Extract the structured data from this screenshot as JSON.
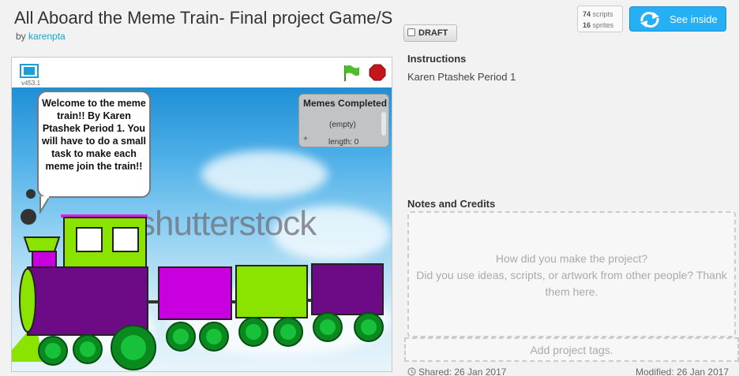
{
  "project": {
    "title": "All Aboard the Meme Train- Final project Game/S",
    "by_label": "by",
    "author": "karenpta",
    "draft_label": "DRAFT",
    "stats": {
      "scripts_count": "74",
      "scripts_label": "scripts",
      "sprites_count": "16",
      "sprites_label": "sprites"
    },
    "see_inside_label": "See inside"
  },
  "player": {
    "version": "v453.1",
    "speech": "Welcome to the meme train!! By Karen Ptashek Period 1. You will have to do a small task to make each meme join the train!!",
    "watermark": "shutterstock",
    "list_monitor": {
      "title": "Memes Completed",
      "empty_text": "(empty)",
      "plus": "+",
      "length_text": "length: 0"
    }
  },
  "info": {
    "instructions_heading": "Instructions",
    "instructions_text": "Karen Ptashek Period 1",
    "notes_heading": "Notes and Credits",
    "notes_placeholder": "How did you make the project?\nDid you use ideas, scripts, or artwork from other people? Thank them here.",
    "tags_placeholder": "Add project tags.",
    "shared": "Shared: 26 Jan 2017",
    "modified": "Modified: 26 Jan 2017"
  },
  "colors": {
    "accent": "#25aff4",
    "link": "#1aa0d8",
    "stop": "#c0161c",
    "flag": "#4cbf28",
    "train_purple": "#6d0a85",
    "train_magenta": "#c800e0",
    "train_lime": "#8be400",
    "wheel_green": "#0a8a1e"
  }
}
